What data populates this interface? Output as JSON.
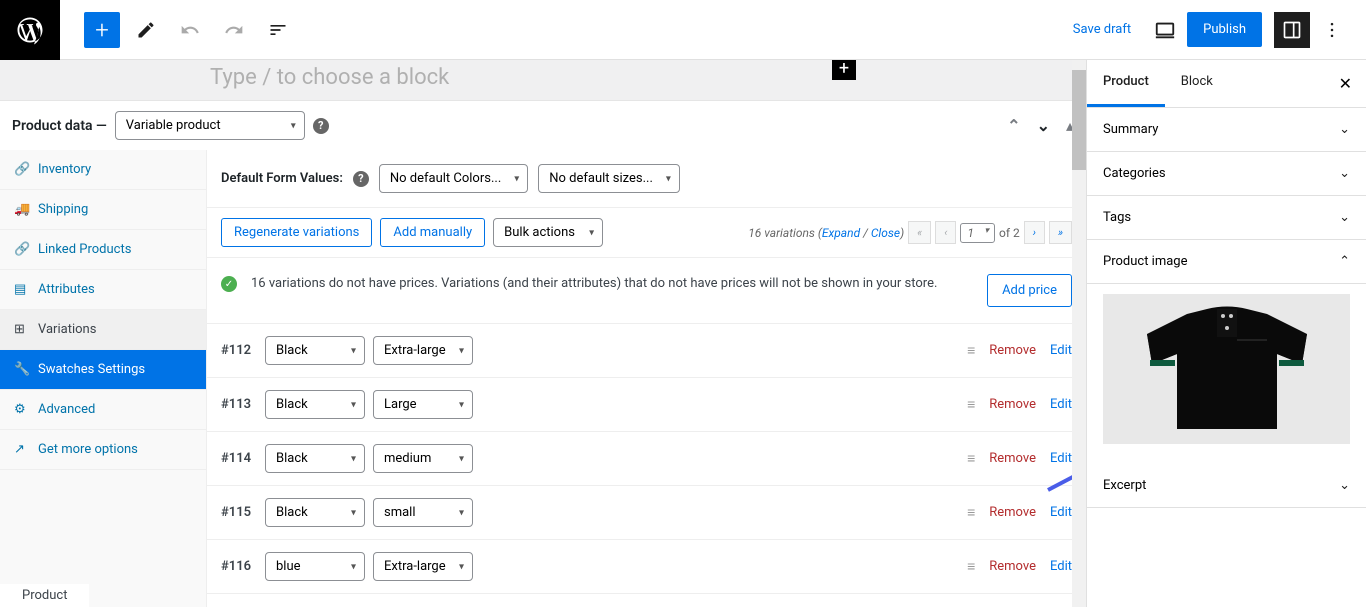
{
  "topbar": {
    "save_draft": "Save draft",
    "publish": "Publish"
  },
  "editor": {
    "block_hint": "Type / to choose a block"
  },
  "product_data": {
    "label": "Product data —",
    "type": "Variable product"
  },
  "tabs": [
    {
      "icon": "🔗",
      "label": "Inventory"
    },
    {
      "icon": "🚚",
      "label": "Shipping"
    },
    {
      "icon": "🔗",
      "label": "Linked Products"
    },
    {
      "icon": "▤",
      "label": "Attributes"
    },
    {
      "icon": "⊞",
      "label": "Variations"
    },
    {
      "icon": "🔧",
      "label": "Swatches Settings"
    },
    {
      "icon": "⚙",
      "label": "Advanced"
    },
    {
      "icon": "↗",
      "label": "Get more options"
    }
  ],
  "default_form": {
    "label": "Default Form Values:",
    "colors": "No default Colors...",
    "sizes": "No default sizes..."
  },
  "action_buttons": {
    "regenerate": "Regenerate variations",
    "add_manually": "Add manually",
    "bulk": "Bulk actions"
  },
  "pagination": {
    "count_text": "16 variations",
    "expand": "Expand",
    "close": "Close",
    "page": "1",
    "of_text": "of 2"
  },
  "notice": {
    "text": "16 variations do not have prices. Variations (and their attributes) that do not have prices will not be shown in your store.",
    "add_price": "Add price"
  },
  "variations": [
    {
      "id": "#112",
      "color": "Black",
      "size": "Extra-large"
    },
    {
      "id": "#113",
      "color": "Black",
      "size": "Large"
    },
    {
      "id": "#114",
      "color": "Black",
      "size": "medium"
    },
    {
      "id": "#115",
      "color": "Black",
      "size": "small"
    },
    {
      "id": "#116",
      "color": "blue",
      "size": "Extra-large"
    }
  ],
  "var_actions": {
    "remove": "Remove",
    "edit": "Edit"
  },
  "sidebar": {
    "tab_product": "Product",
    "tab_block": "Block",
    "panels": {
      "summary": "Summary",
      "categories": "Categories",
      "tags": "Tags",
      "product_image": "Product image",
      "excerpt": "Excerpt"
    }
  },
  "footer": "Product"
}
